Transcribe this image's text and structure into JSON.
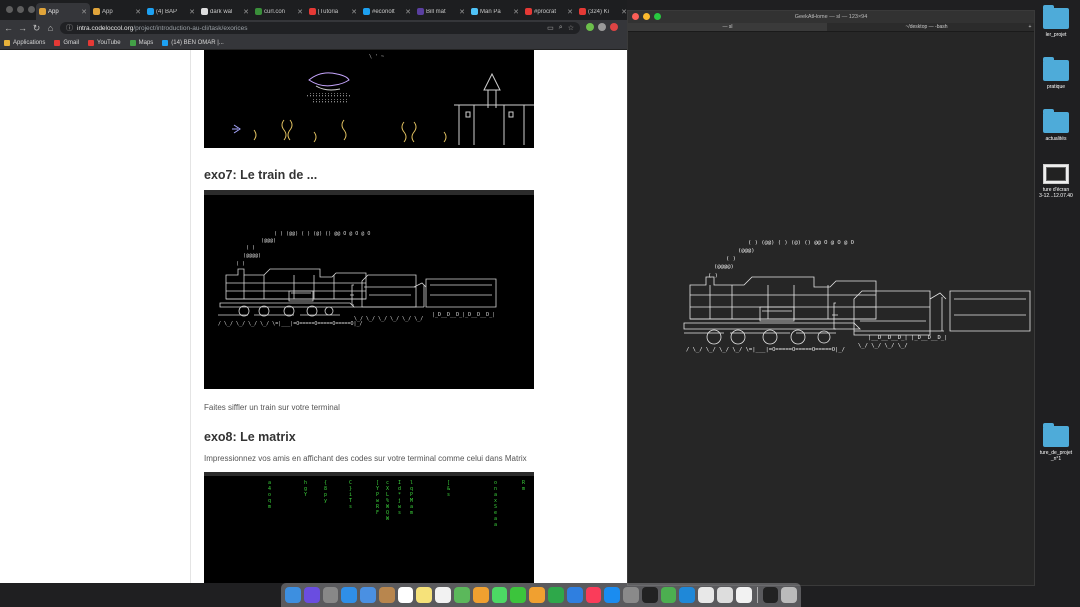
{
  "browser": {
    "tabs": [
      {
        "label": "App",
        "color": "#e0a43a",
        "active": true
      },
      {
        "label": "App",
        "color": "#e0a43a"
      },
      {
        "label": "(4) BAP",
        "color": "#1da1f2"
      },
      {
        "label": "dark wal",
        "color": "#dddddd"
      },
      {
        "label": "curl.con",
        "color": "#3a8f3a"
      },
      {
        "label": "[Tutoria",
        "color": "#e53935"
      },
      {
        "label": "#econolt",
        "color": "#1da1f2"
      },
      {
        "label": "Bill mat",
        "color": "#5a3fa0"
      },
      {
        "label": "Man Pa",
        "color": "#4fc3f7"
      },
      {
        "label": "#procrat",
        "color": "#e53935"
      },
      {
        "label": "(324) Ki",
        "color": "#e53935"
      }
    ],
    "url_host": "intra.codeloccol.org",
    "url_path": "/project/introduction-au-cli/task/exorices",
    "bookmarks": [
      {
        "label": "Applications",
        "color": "#e8b23a"
      },
      {
        "label": "Gmail",
        "color": "#e53935"
      },
      {
        "label": "YouTube",
        "color": "#e53935"
      },
      {
        "label": "Maps",
        "color": "#43a047"
      },
      {
        "label": "(14) BEN OMAR |...",
        "color": "#1da1f2"
      }
    ]
  },
  "page": {
    "exo7_title": "exo7: Le train de ...",
    "exo7_text": "Faites siffler un train sur votre terminal",
    "exo8_title": "exo8: Le matrix",
    "exo8_text": "Impressionnez vos amis en affichant des codes sur votre terminal comme celui dans Matrix"
  },
  "terminal": {
    "title": "GeekAtHome — sl — 123×94",
    "tabs": [
      "— sl",
      "~/desktop — -bash"
    ],
    "add": "+"
  },
  "desktop_icons": [
    {
      "label": "ler_projet",
      "type": "folder"
    },
    {
      "label": "pratique",
      "type": "folder"
    },
    {
      "label": "actualités",
      "type": "folder"
    },
    {
      "label": "ture d'écran\n3-12...12.07.40",
      "type": "screenshot"
    },
    {
      "label": "ture_de_projet\n_n°1",
      "type": "folder"
    }
  ],
  "dock": {
    "items": [
      {
        "name": "finder",
        "color": "#3d8fe0"
      },
      {
        "name": "siri",
        "color": "#6a4de0"
      },
      {
        "name": "launchpad",
        "color": "#888888"
      },
      {
        "name": "safari",
        "color": "#2f8fe8"
      },
      {
        "name": "mail",
        "color": "#4a90e2"
      },
      {
        "name": "contacts",
        "color": "#b8864e"
      },
      {
        "name": "calendar",
        "color": "#ffffff"
      },
      {
        "name": "notes",
        "color": "#f6e27a"
      },
      {
        "name": "reminders",
        "color": "#f2f2f2"
      },
      {
        "name": "maps",
        "color": "#5bb85b"
      },
      {
        "name": "photos",
        "color": "#f0a030"
      },
      {
        "name": "messages",
        "color": "#4cd964"
      },
      {
        "name": "facetime",
        "color": "#3cc43c"
      },
      {
        "name": "pages",
        "color": "#f0a030"
      },
      {
        "name": "numbers",
        "color": "#2ea84a"
      },
      {
        "name": "keynote",
        "color": "#2f7fe0"
      },
      {
        "name": "music",
        "color": "#fa3c5a"
      },
      {
        "name": "app-store",
        "color": "#1a8cf0"
      },
      {
        "name": "system-preferences",
        "color": "#8a8a8a"
      },
      {
        "name": "terminal",
        "color": "#222222"
      },
      {
        "name": "utorrent",
        "color": "#4caf50"
      },
      {
        "name": "vscode",
        "color": "#1f88d8"
      },
      {
        "name": "chrome",
        "color": "#e8e8e8"
      },
      {
        "name": "preview",
        "color": "#dddddd"
      },
      {
        "name": "textedit",
        "color": "#f2f2f2"
      },
      {
        "name": "terminal-window",
        "color": "#222222"
      },
      {
        "name": "trash",
        "color": "#bbbbbb"
      }
    ]
  }
}
